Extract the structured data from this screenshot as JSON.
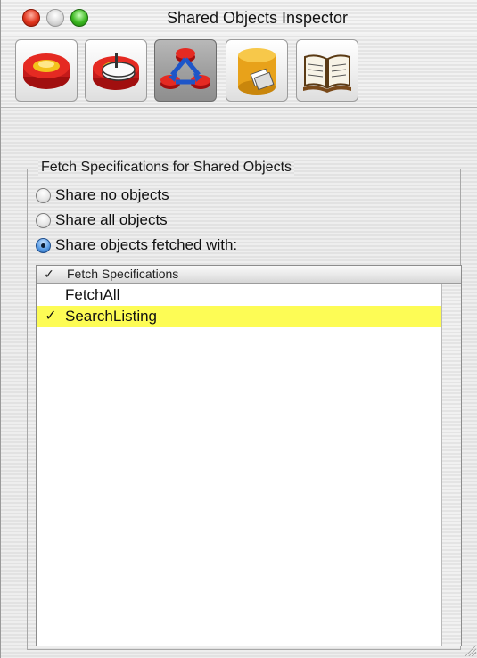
{
  "window": {
    "title": "Shared Objects Inspector"
  },
  "toolbar": {
    "buttons": [
      {
        "icon": "entity-inspector-icon",
        "active": false
      },
      {
        "icon": "advanced-entity-icon",
        "active": false
      },
      {
        "icon": "shared-objects-icon",
        "active": true
      },
      {
        "icon": "stored-procedure-icon",
        "active": false
      },
      {
        "icon": "documentation-icon",
        "active": false
      }
    ]
  },
  "group": {
    "title": "Fetch Specifications for Shared Objects",
    "options": [
      {
        "label": "Share no objects",
        "selected": false
      },
      {
        "label": "Share all objects",
        "selected": false
      },
      {
        "label": "Share objects fetched with:",
        "selected": true
      }
    ]
  },
  "table": {
    "check_header": "✓",
    "name_header": "Fetch Specifications",
    "rows": [
      {
        "checked": false,
        "check_mark": "",
        "name": "FetchAll",
        "selected": false
      },
      {
        "checked": true,
        "check_mark": "✓",
        "name": "SearchListing",
        "selected": true
      }
    ]
  },
  "colors": {
    "selection_highlight": "#fdfc55",
    "close_button": "#e0341c",
    "zoom_button": "#3ab71f",
    "radio_selected": "#5c9ee6"
  }
}
